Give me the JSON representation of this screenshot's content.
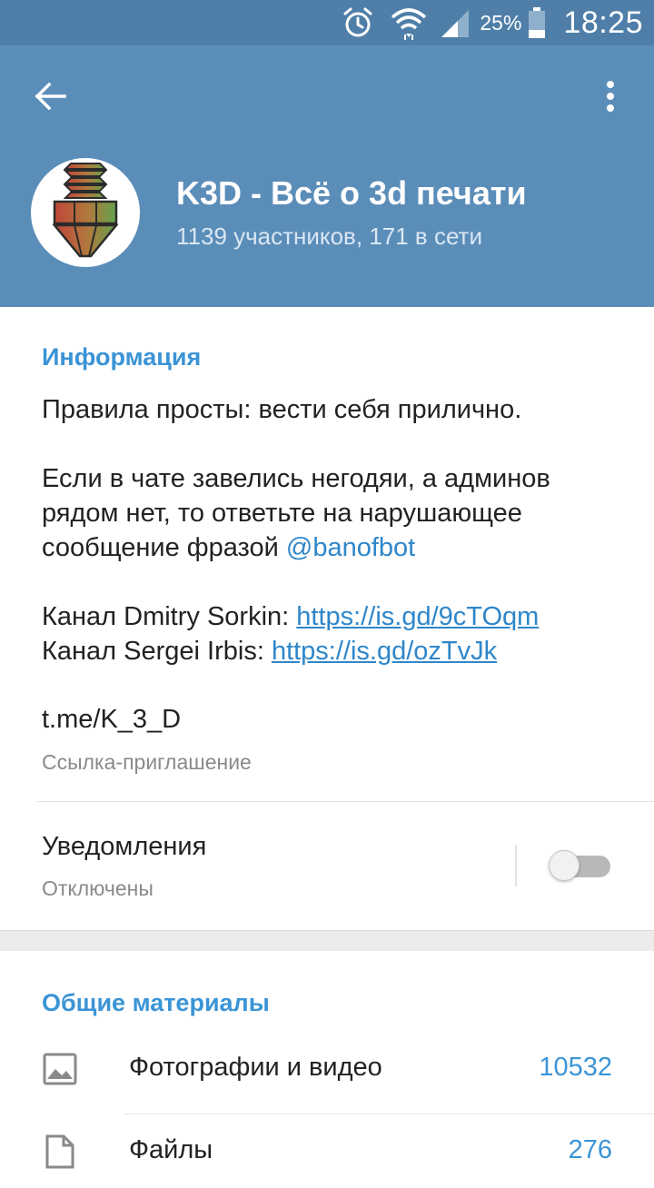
{
  "status_bar": {
    "battery": "25%",
    "time": "18:25"
  },
  "header": {
    "title": "K3D - Всё о 3d печати",
    "subtitle": "1139 участников, 171 в сети"
  },
  "info": {
    "section_title": "Информация",
    "rules": "Правила просты: вести себя прилично.",
    "para2_text": "Если в чате завелись негодяи, а админов рядом нет, то ответьте на нарушающее сообщение фразой ",
    "para2_mention": "@banofbot",
    "channel1_label": "Канал Dmitry Sorkin: ",
    "channel1_link": "https://is.gd/9cTOqm",
    "channel2_label": "Канал Sergei Irbis: ",
    "channel2_link": "https://is.gd/ozTvJk",
    "invite_link": "t.me/K_3_D",
    "invite_caption": "Ссылка-приглашение",
    "notifications_label": "Уведомления",
    "notifications_state": "Отключены"
  },
  "media": {
    "section_title": "Общие материалы",
    "rows": [
      {
        "label": "Фотографии и видео",
        "count": "10532",
        "icon": "image-icon"
      },
      {
        "label": "Файлы",
        "count": "276",
        "icon": "file-icon"
      }
    ]
  },
  "colors": {
    "header_bg": "#5b8db9",
    "status_bg": "#4f7fa8",
    "accent": "#3b94d6"
  }
}
